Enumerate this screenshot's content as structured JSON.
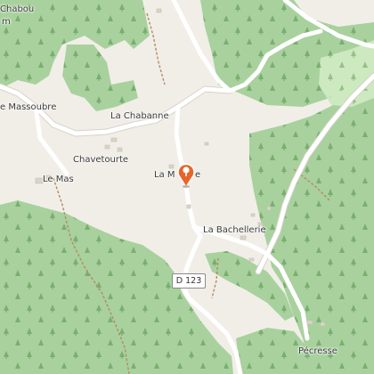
{
  "map": {
    "place_labels": {
      "chabou": "Chabou",
      "chabou_suffix": "m",
      "massoubre": "e Massoubre",
      "la_chabanne": "La Chabanne",
      "chavetourte": "Chavetourte",
      "le_mas": "Le Mas",
      "la_m_left": "La M",
      "la_m_right": "e",
      "la_bachellerie": "La Bachellerie",
      "pecresse": "Pécresse"
    },
    "road_label": "D 123",
    "marker_icon": "location-pin-icon",
    "colors": {
      "background": "#f1eee8",
      "forest": "#a8d19e",
      "meadow": "#cde9bf",
      "road": "#ffffff",
      "trail": "#b88a5c",
      "marker": "#e8652c"
    }
  }
}
